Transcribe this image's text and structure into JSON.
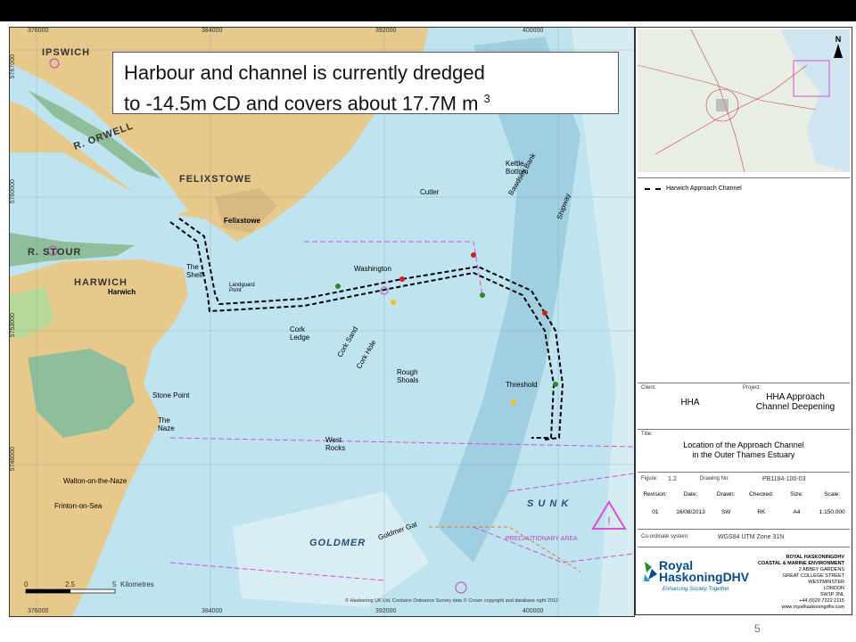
{
  "callout": {
    "line1": "Harbour and channel is currently dredged",
    "line2": "to -14.5m CD and covers about 17.7M m",
    "superscript": "3"
  },
  "map": {
    "grid_x": [
      "376000",
      "384000",
      "392000",
      "400000"
    ],
    "grid_x_bottom": [
      "376000",
      "384000",
      "392000",
      "400000"
    ],
    "grid_y": [
      "5767000",
      "5760000",
      "5753000",
      "5746000"
    ],
    "places": {
      "ipswich": "IPSWICH",
      "orwell": "R. ORWELL",
      "felixstowe_caps": "FELIXSTOWE",
      "felixstowe": "Felixstowe",
      "stour": "R. STOUR",
      "harwich_caps": "HARWICH",
      "harwich": "Harwich",
      "the_shelf": "The Shelf",
      "landguard": "Landguard Point",
      "cork_ledge": "Cork Ledge",
      "cork_sand": "Cork Sand",
      "cork_hole": "Cork Hole",
      "rough_shoals": "Rough Shoals",
      "west_rocks": "West Rocks",
      "the_naze": "The Naze",
      "stone_point": "Stone Point",
      "walton": "Walton-on-the-Naze",
      "frinton": "Frinton-on-Sea",
      "goldmer": "GOLDMER",
      "goldmer_gat": "Goldmer Gat",
      "threshold": "Threshold",
      "shipway": "Shipway",
      "bawdsey_bank": "Bawdsey Bank",
      "sunk": "S U N K",
      "precautionary": "PRECAUTIONARY AREA",
      "washington": "Washington",
      "cutler": "Cutler",
      "kettle_bottom": "Kettle Bottom"
    },
    "scale": {
      "ticks": [
        "0",
        "2.5",
        "5"
      ],
      "unit": "Kilometres"
    },
    "copyright": "© Haskoning UK Ltd. Contains Ordnance Survey data © Crown copyright and database right 2012"
  },
  "panel": {
    "north": "N",
    "legend_title": "Harwich Approach Channel",
    "client_label": "Client:",
    "client": "HHA",
    "project_label": "Project:",
    "project_line1": "HHA Approach",
    "project_line2": "Channel Deepening",
    "title_label": "Title:",
    "title_line1": "Location of the Approach Channel",
    "title_line2": "in the Outer Thames Estuary",
    "figure_label": "Figure:",
    "figure": "1.2",
    "drawing_label": "Drawing No:",
    "drawing": "PB1184-100-03",
    "cols": [
      "Revision:",
      "Date:",
      "Drawn:",
      "Checked:",
      "Size:",
      "Scale:"
    ],
    "vals": [
      "01",
      "16/08/2013",
      "SW",
      "RK",
      "A4",
      "1:150,000"
    ],
    "coord_label": "Co-ordinate system:",
    "coord": "WGS84 UTM Zone 31N",
    "company_line1": "Royal",
    "company_line2": "HaskoningDHV",
    "tagline": "Enhancing Society Together",
    "address": [
      "ROYAL HASKONINGDHV",
      "COASTAL & MARINE ENVIRONMENT",
      "2 ABBEY GARDENS",
      "GREAT COLLEGE STREET",
      "WESTMINSTER",
      "LONDON",
      "SW1P 3NL",
      "+44 (0)20 7222 2115",
      "www.royalhaskoningdhv.com"
    ]
  },
  "page_number": "5",
  "colors": {
    "land": "#e8c98c",
    "sea": "#bfe4ef",
    "shallow": "#9fcfe0",
    "mud": "#8fbf9a",
    "channel": "#000000",
    "boundary": "#d84fd8"
  }
}
